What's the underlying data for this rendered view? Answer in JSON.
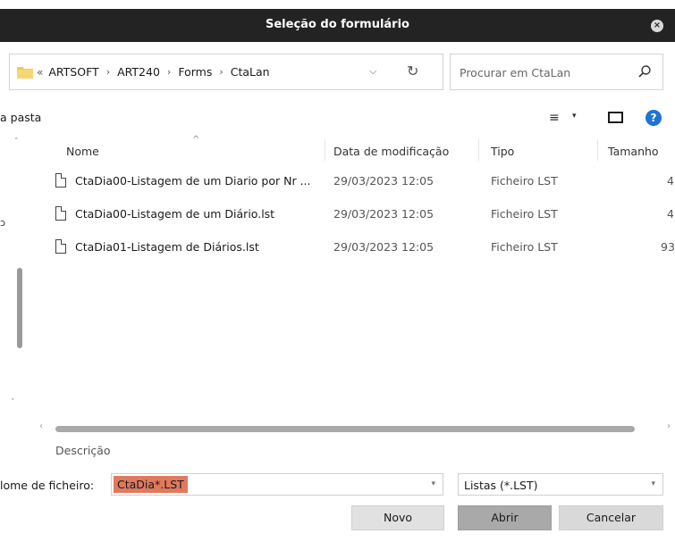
{
  "window": {
    "title": "Seleção do formulário",
    "close_glyph": "×"
  },
  "address": {
    "overflow_glyph": "«",
    "crumbs": [
      "ARTSOFT",
      "ART240",
      "Forms",
      "CtaLan"
    ],
    "separator": "›",
    "dropdown_glyph": "⌵",
    "refresh_glyph": "↻"
  },
  "search": {
    "placeholder": "Procurar em CtaLan",
    "icon": "search-icon"
  },
  "toolbar": {
    "new_folder_label": "a pasta",
    "view_glyph": "≡",
    "view_caret": "▾",
    "help_glyph": "?"
  },
  "nav": {
    "fragment": "ɔ",
    "scroll_up": "˄",
    "scroll_down": "˅"
  },
  "columns": {
    "name": "Nome",
    "modified": "Data de modificação",
    "type": "Tipo",
    "size": "Tamanho",
    "sort_glyph": "^"
  },
  "files": [
    {
      "name": "CtaDia00-Listagem de um Diario por Nr ...",
      "modified": "29/03/2023 12:05",
      "type": "Ficheiro LST",
      "size": "4"
    },
    {
      "name": "CtaDia00-Listagem de um Diário.lst",
      "modified": "29/03/2023 12:05",
      "type": "Ficheiro LST",
      "size": "4"
    },
    {
      "name": "CtaDia01-Listagem de Diários.lst",
      "modified": "29/03/2023 12:05",
      "type": "Ficheiro LST",
      "size": "93"
    }
  ],
  "hscroll": {
    "left_glyph": "‹",
    "right_glyph": "›"
  },
  "description_label": "Descrição",
  "filename": {
    "label": "lome de ficheiro:",
    "value": "CtaDia*.LST",
    "caret": "▾"
  },
  "filter": {
    "value": "Listas (*.LST)",
    "caret": "▾"
  },
  "buttons": {
    "new": "Novo",
    "open": "Abrir",
    "cancel": "Cancelar"
  },
  "colors": {
    "titlebar": "#232323",
    "selection_highlight": "#e07a5f",
    "help_blue": "#1d74d7",
    "folder_yellow": "#f2c94c"
  }
}
